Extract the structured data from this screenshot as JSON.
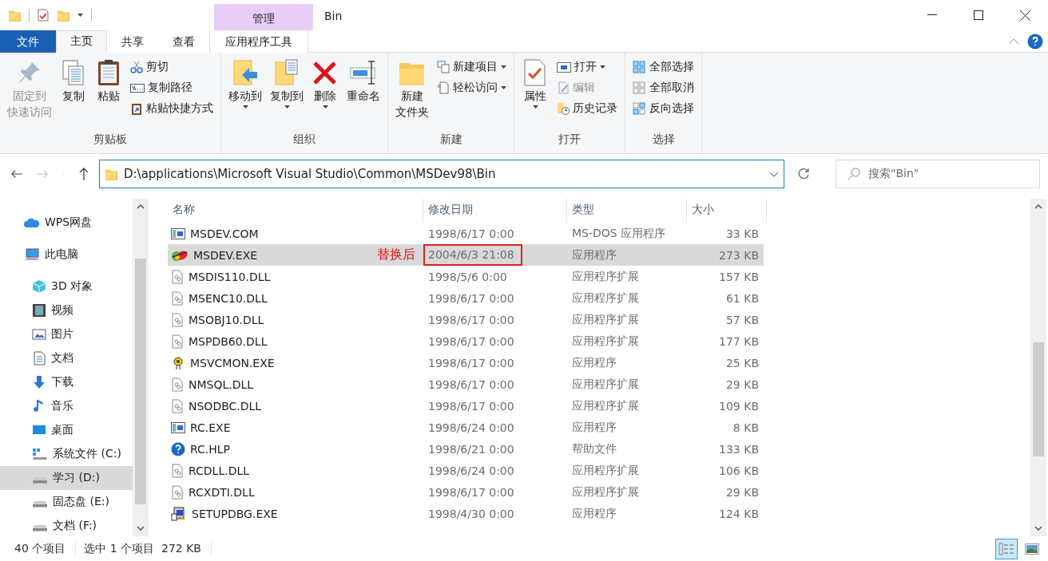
{
  "window": {
    "title": "Bin",
    "context_tab": "管理"
  },
  "ribbon_tabs": [
    {
      "label": "文件",
      "kind": "file",
      "selected": false
    },
    {
      "label": "主页",
      "kind": "tab",
      "selected": true
    },
    {
      "label": "共享",
      "kind": "tab",
      "selected": false
    },
    {
      "label": "查看",
      "kind": "tab",
      "selected": false
    },
    {
      "label": "应用程序工具",
      "kind": "context",
      "selected": false
    }
  ],
  "ribbon_groups": [
    {
      "label": "剪贴板",
      "large": [
        {
          "lines": [
            "固定到",
            "快速访问"
          ],
          "kind": "pin",
          "disabled": true,
          "dropdown": false
        },
        {
          "lines": [
            "复制"
          ],
          "kind": "copy",
          "disabled": false,
          "dropdown": false
        },
        {
          "lines": [
            "粘贴"
          ],
          "kind": "paste",
          "disabled": false,
          "dropdown": false
        }
      ],
      "small": [
        {
          "label": "剪切",
          "kind": "scissors",
          "disabled": false,
          "dropdown": false
        },
        {
          "label": "复制路径",
          "kind": "path",
          "disabled": false,
          "dropdown": false
        },
        {
          "label": "粘贴快捷方式",
          "kind": "shortcut",
          "disabled": false,
          "dropdown": false
        }
      ]
    },
    {
      "label": "组织",
      "large": [
        {
          "lines": [
            "移动到"
          ],
          "kind": "move",
          "disabled": false,
          "dropdown": true
        },
        {
          "lines": [
            "复制到"
          ],
          "kind": "copyto",
          "disabled": false,
          "dropdown": true
        },
        {
          "lines": [
            "删除"
          ],
          "kind": "delete",
          "disabled": false,
          "dropdown": true
        },
        {
          "lines": [
            "重命名"
          ],
          "kind": "rename",
          "disabled": false,
          "dropdown": false
        }
      ]
    },
    {
      "label": "新建",
      "large": [
        {
          "lines": [
            "新建",
            "文件夹"
          ],
          "kind": "folder",
          "disabled": false,
          "dropdown": false
        }
      ],
      "small": [
        {
          "label": "新建项目",
          "kind": "newitem",
          "disabled": false,
          "dropdown": true
        },
        {
          "label": "轻松访问",
          "kind": "easy",
          "disabled": false,
          "dropdown": true
        }
      ]
    },
    {
      "label": "打开",
      "large": [
        {
          "lines": [
            "属性"
          ],
          "kind": "props",
          "disabled": false,
          "dropdown": true
        }
      ],
      "small": [
        {
          "label": "打开",
          "kind": "open",
          "disabled": false,
          "dropdown": true
        },
        {
          "label": "编辑",
          "kind": "edit",
          "disabled": true,
          "dropdown": false
        },
        {
          "label": "历史记录",
          "kind": "history",
          "disabled": false,
          "dropdown": false
        }
      ]
    },
    {
      "label": "选择",
      "small": [
        {
          "label": "全部选择",
          "kind": "selall",
          "disabled": false,
          "dropdown": false
        },
        {
          "label": "全部取消",
          "kind": "selnone",
          "disabled": false,
          "dropdown": false
        },
        {
          "label": "反向选择",
          "kind": "selinv",
          "disabled": false,
          "dropdown": false
        }
      ]
    }
  ],
  "address": {
    "path": "D:\\applications\\Microsoft Visual Studio\\Common\\MSDev98\\Bin"
  },
  "search": {
    "placeholder": "搜索\"Bin\""
  },
  "sidebar": {
    "items": [
      {
        "label": "WPS网盘",
        "kind": "cloud",
        "selected": false
      },
      {
        "label": "此电脑",
        "kind": "pc",
        "selected": false
      },
      {
        "label": "3D 对象",
        "kind": "cube",
        "selected": false
      },
      {
        "label": "视频",
        "kind": "video",
        "selected": false
      },
      {
        "label": "图片",
        "kind": "picture",
        "selected": false
      },
      {
        "label": "文档",
        "kind": "doc",
        "selected": false
      },
      {
        "label": "下载",
        "kind": "download",
        "selected": false
      },
      {
        "label": "音乐",
        "kind": "music",
        "selected": false
      },
      {
        "label": "桌面",
        "kind": "desktop",
        "selected": false
      },
      {
        "label": "系统文件 (C:)",
        "kind": "sysdrive",
        "selected": false
      },
      {
        "label": "学习 (D:)",
        "kind": "drive",
        "selected": true
      },
      {
        "label": "固态盘 (E:)",
        "kind": "drive",
        "selected": false
      },
      {
        "label": "文档 (F:)",
        "kind": "drive",
        "selected": false
      }
    ]
  },
  "table": {
    "columns": [
      "名称",
      "修改日期",
      "类型",
      "大小"
    ],
    "rows": [
      {
        "name": "MSDEV.COM",
        "date": "1998/6/17 0:00",
        "type": "MS-DOS 应用程序",
        "size": "33 KB",
        "kind": "window",
        "selected": false
      },
      {
        "name": "MSDEV.EXE",
        "date": "2004/6/3 21:08",
        "type": "应用程序",
        "size": "273 KB",
        "kind": "colorful",
        "selected": true,
        "note": "替换后",
        "boxed": true
      },
      {
        "name": "MSDIS110.DLL",
        "date": "1998/5/6 0:00",
        "type": "应用程序扩展",
        "size": "157 KB",
        "kind": "dll",
        "selected": false
      },
      {
        "name": "MSENC10.DLL",
        "date": "1998/6/17 0:00",
        "type": "应用程序扩展",
        "size": "61 KB",
        "kind": "dll",
        "selected": false
      },
      {
        "name": "MSOBJ10.DLL",
        "date": "1998/6/17 0:00",
        "type": "应用程序扩展",
        "size": "57 KB",
        "kind": "dll",
        "selected": false
      },
      {
        "name": "MSPDB60.DLL",
        "date": "1998/6/17 0:00",
        "type": "应用程序扩展",
        "size": "177 KB",
        "kind": "dll",
        "selected": false
      },
      {
        "name": "MSVCMON.EXE",
        "date": "1998/6/17 0:00",
        "type": "应用程序",
        "size": "25 KB",
        "kind": "gear",
        "selected": false
      },
      {
        "name": "NMSQL.DLL",
        "date": "1998/6/17 0:00",
        "type": "应用程序扩展",
        "size": "29 KB",
        "kind": "dll",
        "selected": false
      },
      {
        "name": "NSODBC.DLL",
        "date": "1998/6/17 0:00",
        "type": "应用程序扩展",
        "size": "109 KB",
        "kind": "dll",
        "selected": false
      },
      {
        "name": "RC.EXE",
        "date": "1998/6/24 0:00",
        "type": "应用程序",
        "size": "8 KB",
        "kind": "window",
        "selected": false
      },
      {
        "name": "RC.HLP",
        "date": "1998/6/21 0:00",
        "type": "帮助文件",
        "size": "133 KB",
        "kind": "help",
        "selected": false
      },
      {
        "name": "RCDLL.DLL",
        "date": "1998/6/24 0:00",
        "type": "应用程序扩展",
        "size": "106 KB",
        "kind": "dll",
        "selected": false
      },
      {
        "name": "RCXDTI.DLL",
        "date": "1998/6/17 0:00",
        "type": "应用程序扩展",
        "size": "29 KB",
        "kind": "dll",
        "selected": false
      },
      {
        "name": "SETUPDBG.EXE",
        "date": "1998/4/30 0:00",
        "type": "应用程序",
        "size": "124 KB",
        "kind": "installer",
        "selected": false
      }
    ]
  },
  "status_bar": {
    "count": "40 个项目",
    "selection": "选中 1 个项目  272 KB"
  },
  "views": [
    {
      "kind": "details",
      "selected": true
    },
    {
      "kind": "thumbs",
      "selected": false
    }
  ]
}
